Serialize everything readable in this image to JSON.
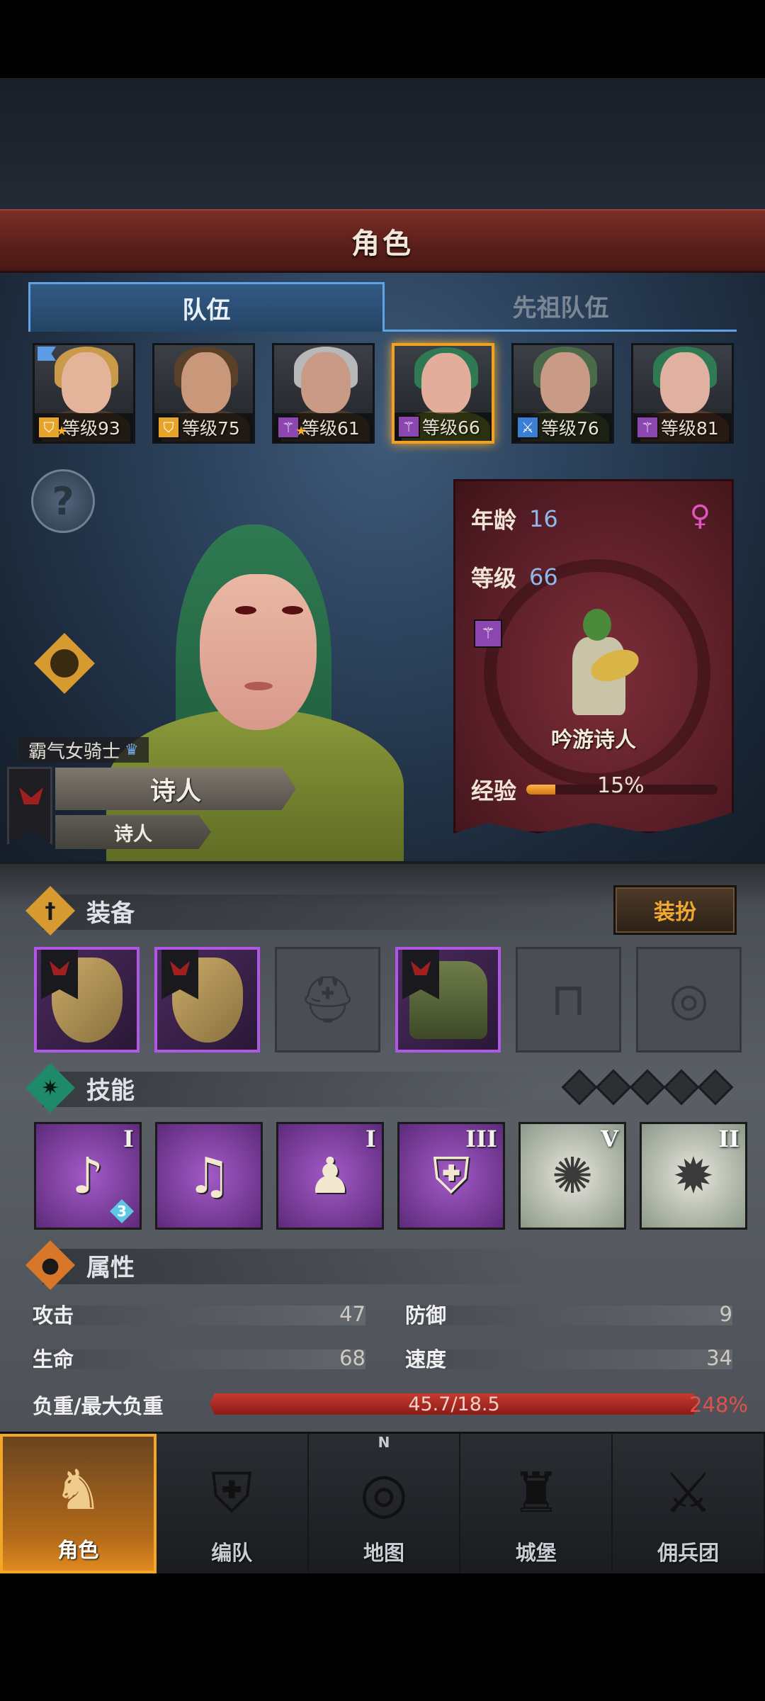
{
  "header": {
    "title": "角色"
  },
  "tabs": [
    {
      "label": "队伍",
      "active": true
    },
    {
      "label": "先祖队伍",
      "active": false
    }
  ],
  "roster": [
    {
      "level_text": "等级93",
      "class_icon": "shield-icon",
      "class_color": "#e6a428",
      "hair": "#c89a4a",
      "face": "#e4b49a",
      "selected": false
    },
    {
      "level_text": "等级75",
      "class_icon": "shield-icon",
      "class_color": "#e6a428",
      "hair": "#5a4028",
      "face": "#c9977a",
      "selected": false
    },
    {
      "level_text": "等级61",
      "class_icon": "staff-icon",
      "class_color": "#8b46b0",
      "hair": "#b8b8b8",
      "face": "#c99a86",
      "selected": false
    },
    {
      "level_text": "等级66",
      "class_icon": "staff-icon",
      "class_color": "#8b46b0",
      "hair": "#2f7a52",
      "face": "#e2ad9a",
      "selected": true
    },
    {
      "level_text": "等级76",
      "class_icon": "sword-icon",
      "class_color": "#3b7fd4",
      "hair": "#4a6a4a",
      "face": "#c99a86",
      "selected": false
    },
    {
      "level_text": "等级81",
      "class_icon": "staff-icon",
      "class_color": "#8b46b0",
      "hair": "#2f7a52",
      "face": "#e0b0a0",
      "selected": false
    }
  ],
  "character": {
    "title_tag": "霸气女骑士",
    "class_name": "诗人",
    "sub_name": "诗人",
    "age_label": "年龄",
    "age": "16",
    "level_label": "等级",
    "level": "66",
    "profession": "吟游诗人",
    "exp_label": "经验",
    "exp_percent_text": "15%",
    "exp_fraction": 0.15
  },
  "equipment": {
    "title": "装备",
    "dress_button": "装扮",
    "slots": [
      {
        "kind": "shield",
        "filled": true
      },
      {
        "kind": "shield",
        "filled": true
      },
      {
        "kind": "helmet",
        "filled": false
      },
      {
        "kind": "armor",
        "filled": true
      },
      {
        "kind": "boots",
        "filled": false
      },
      {
        "kind": "ring",
        "filled": false
      }
    ]
  },
  "skills": {
    "title": "技能",
    "points": 5,
    "items": [
      {
        "roman": "I",
        "style": "purple",
        "glyph": "♪",
        "badge": "3"
      },
      {
        "roman": "",
        "style": "purple",
        "glyph": "♫",
        "badge": ""
      },
      {
        "roman": "I",
        "style": "purple",
        "glyph": "♟",
        "badge": ""
      },
      {
        "roman": "III",
        "style": "purple",
        "glyph": "⛨",
        "badge": ""
      },
      {
        "roman": "V",
        "style": "white",
        "glyph": "✺",
        "badge": ""
      },
      {
        "roman": "II",
        "style": "white",
        "glyph": "✹",
        "badge": ""
      }
    ]
  },
  "attributes": {
    "title": "属性",
    "attack_label": "攻击",
    "attack": "47",
    "defense_label": "防御",
    "defense": "9",
    "hp_label": "生命",
    "hp": "68",
    "speed_label": "速度",
    "speed": "34",
    "weight_label": "负重/最大负重",
    "weight_value": "45.7/18.5",
    "weight_percent": "248%"
  },
  "nav": [
    {
      "label": "角色",
      "icon": "knight-icon",
      "active": true
    },
    {
      "label": "编队",
      "icon": "formation-icon",
      "active": false
    },
    {
      "label": "地图",
      "icon": "compass-icon",
      "active": false
    },
    {
      "label": "城堡",
      "icon": "castle-icon",
      "active": false
    },
    {
      "label": "佣兵团",
      "icon": "mercenary-icon",
      "active": false
    }
  ],
  "compass_letter": "N",
  "colors": {
    "accent_gold": "#f3a728",
    "tab_blue": "#5fa3e6",
    "epic_purple": "#b057e6",
    "overweight_red": "#c63a30"
  }
}
